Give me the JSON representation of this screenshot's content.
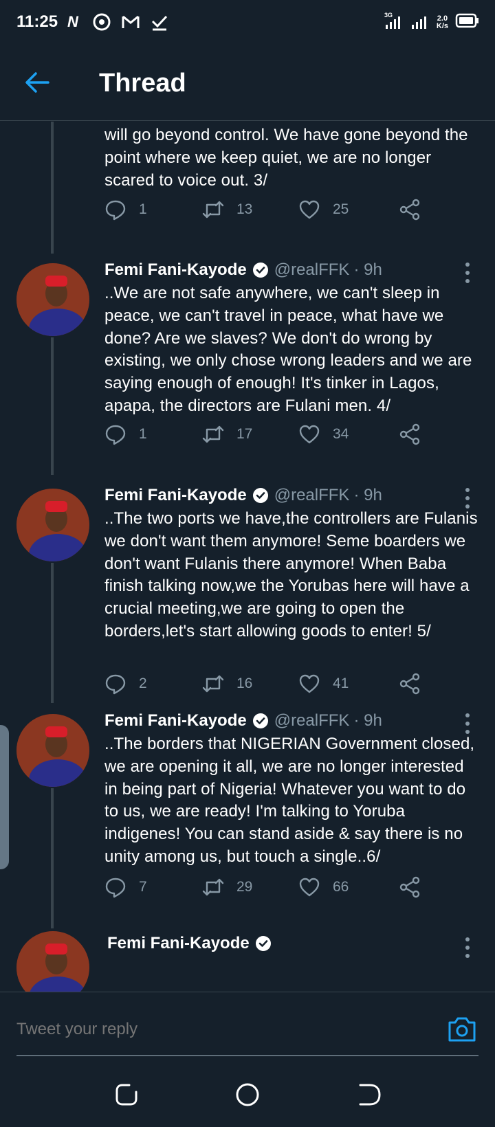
{
  "status_bar": {
    "time": "11:25",
    "notification_icons": [
      "netflix-icon",
      "chrome-icon",
      "gmail-icon",
      "checkmark-icon"
    ],
    "network_speed_value": "2.0",
    "network_speed_unit": "K/s",
    "network_type": "3G"
  },
  "header": {
    "title": "Thread",
    "back_icon": "arrow-left-icon"
  },
  "partial_tweet": {
    "text": "will go beyond control. We have gone beyond the point where we keep quiet, we are no longer scared to voice out. 3/",
    "replies": "1",
    "retweets": "13",
    "likes": "25"
  },
  "tweets": [
    {
      "name": "Femi Fani-Kayode",
      "handle": "@realFFK",
      "time": "· 9h",
      "text": "..We are not safe anywhere, we can't sleep in peace, we can't travel in peace, what have we done? Are we slaves? We don't do wrong by existing, we only chose wrong leaders and we are saying enough of enough! It's tinker in Lagos, apapa, the directors are Fulani men. 4/",
      "replies": "1",
      "retweets": "17",
      "likes": "34"
    },
    {
      "name": "Femi Fani-Kayode",
      "handle": "@realFFK",
      "time": "· 9h",
      "text": "..The two ports we have,the controllers are Fulanis we don't want them anymore! Seme boarders we don't want Fulanis there anymore! When Baba finish talking now,we the Yorubas here will have a crucial meeting,we are going to open the borders,let's start allowing goods to enter! 5/",
      "replies": "2",
      "retweets": "16",
      "likes": "41"
    },
    {
      "name": "Femi Fani-Kayode",
      "handle": "@realFFK",
      "time": "· 9h",
      "text": "..The borders that NIGERIAN Government closed, we are opening it all, we are no longer interested in being part of Nigeria! Whatever you want to do to us, we are ready! I'm talking to Yoruba indigenes! You can stand aside & say there is no unity among us, but touch a single..6/",
      "replies": "7",
      "retweets": "29",
      "likes": "66"
    }
  ],
  "partial_next_tweet": {
    "name": "Femi Fani-Kayode"
  },
  "reply_bar": {
    "placeholder": "Tweet your reply",
    "camera_icon": "camera-icon"
  },
  "colors": {
    "background": "#15202b",
    "accent": "#1da1f2",
    "secondary_text": "#8899a6",
    "divider": "#38444d"
  }
}
